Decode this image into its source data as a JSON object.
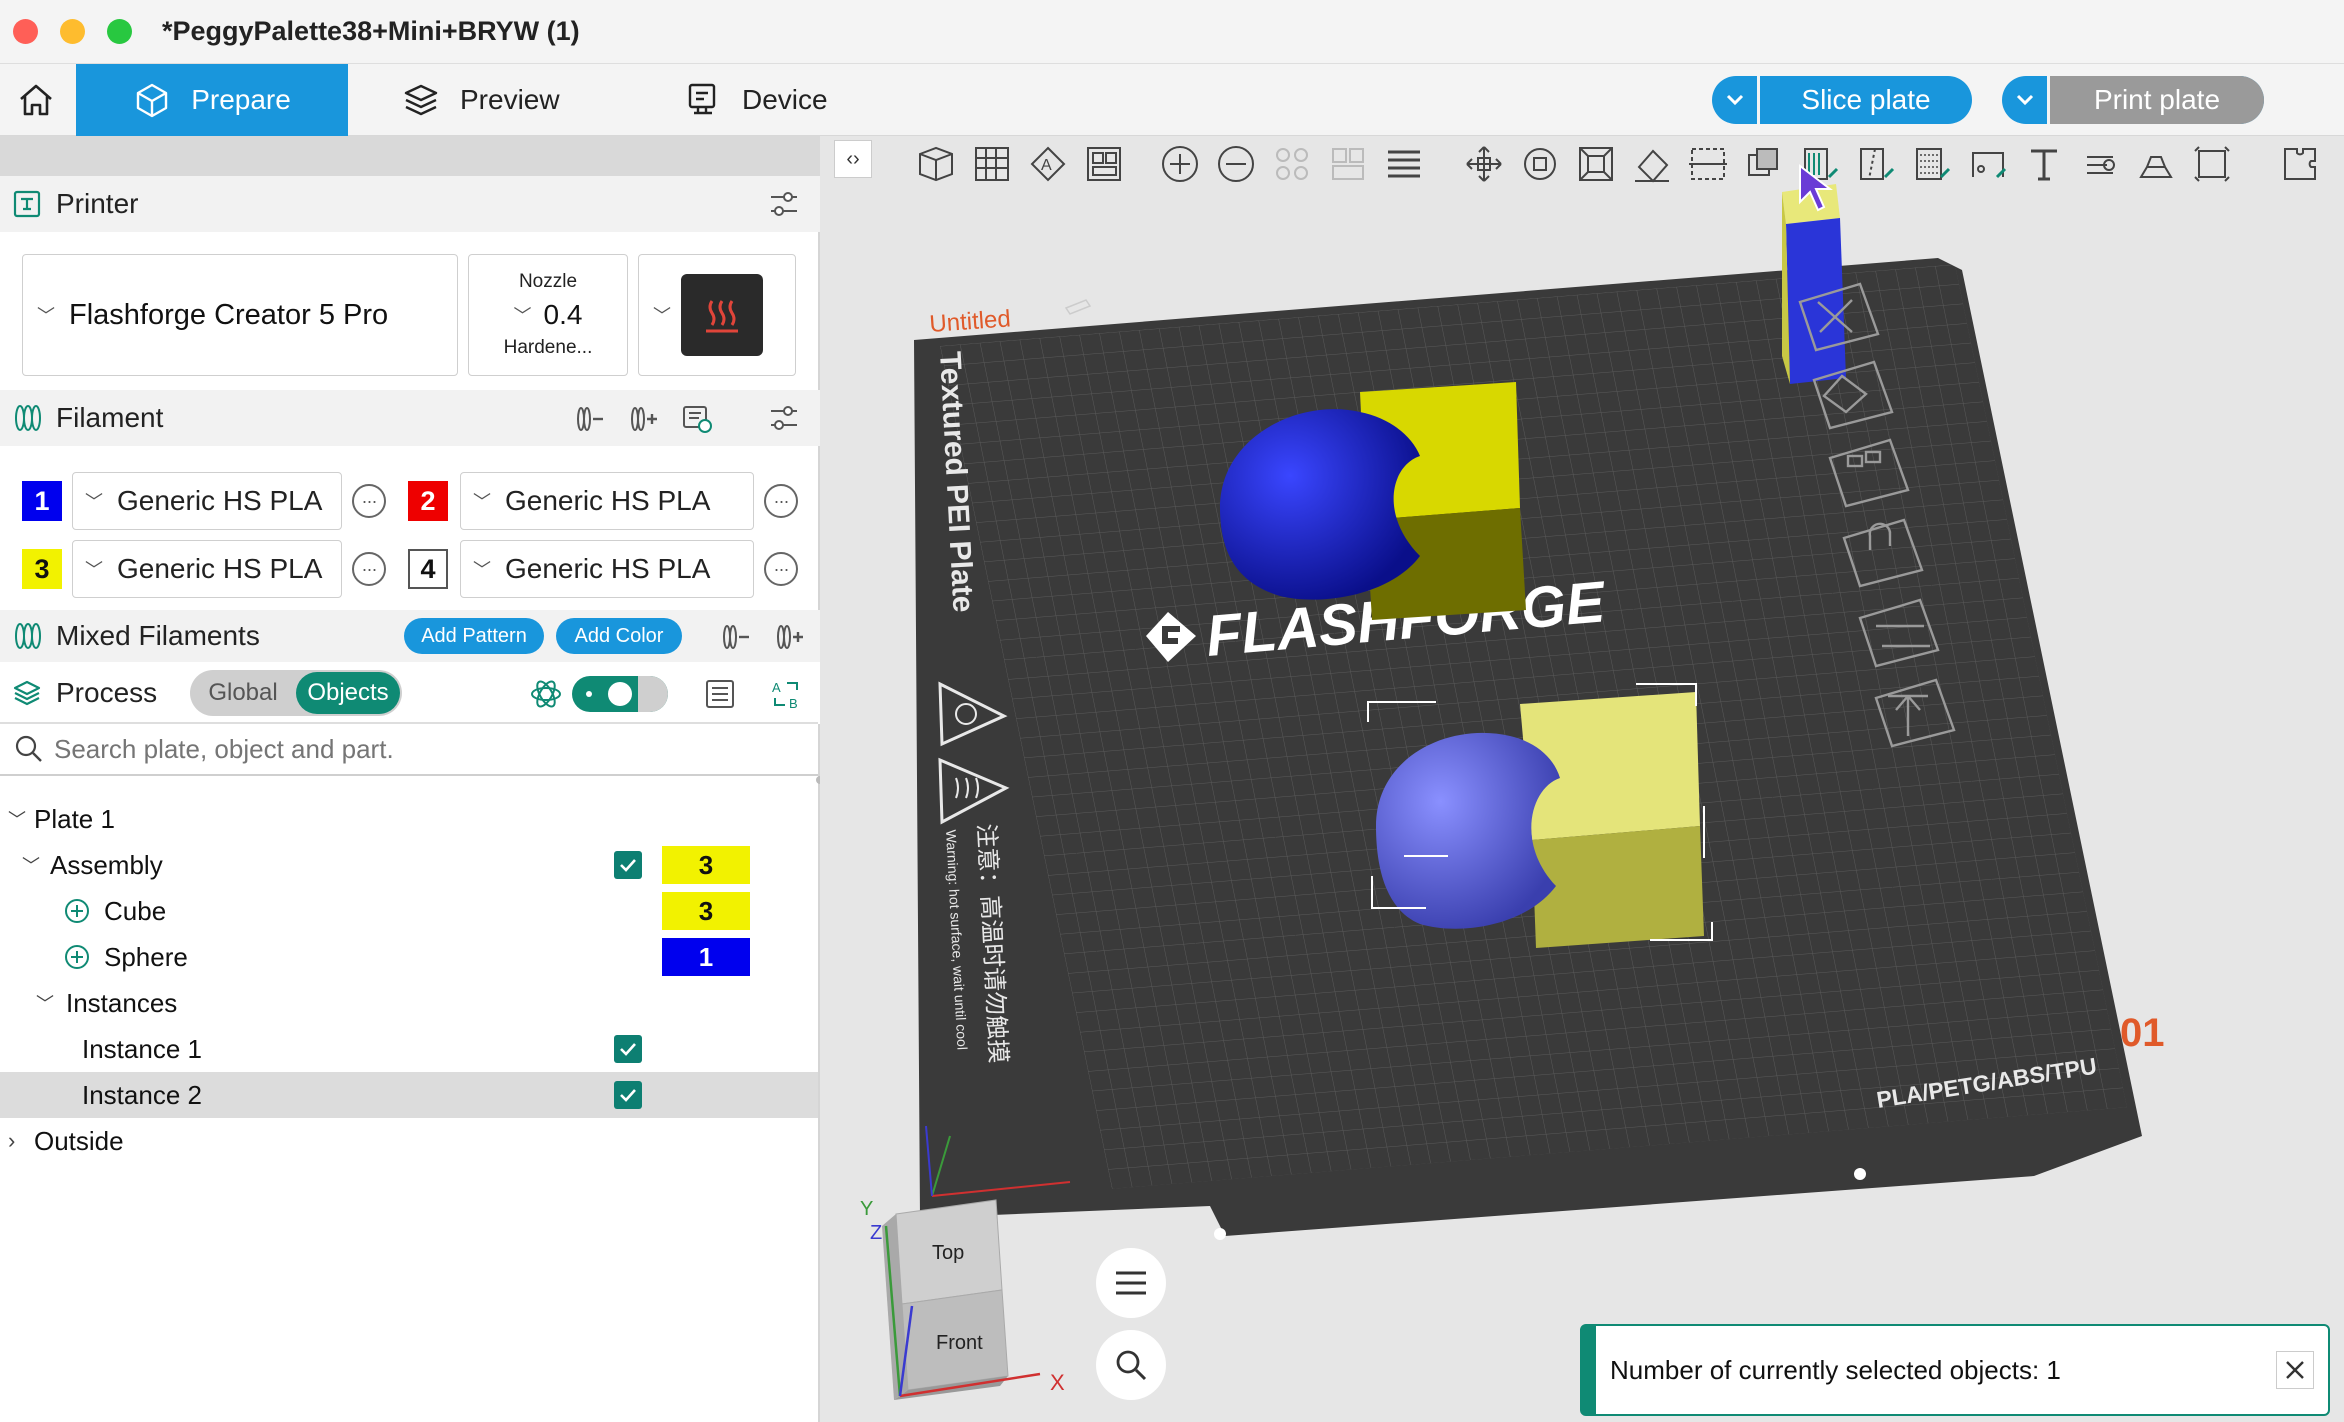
{
  "window": {
    "title": "*PeggyPalette38+Mini+BRYW (1)"
  },
  "tabs": [
    {
      "label": "Prepare"
    },
    {
      "label": "Preview"
    },
    {
      "label": "Device"
    }
  ],
  "actions": {
    "slice_label": "Slice plate",
    "print_label": "Print plate"
  },
  "printer": {
    "header": "Printer",
    "name": "Flashforge Creator 5 Pro",
    "nozzle_label": "Nozzle",
    "nozzle_value": "0.4",
    "nozzle_type": "Hardene..."
  },
  "filament": {
    "header": "Filament",
    "slots": [
      {
        "index": "1",
        "name": "Generic HS PLA",
        "color": "#0000ee",
        "text_color": "#ffffff"
      },
      {
        "index": "2",
        "name": "Generic HS PLA",
        "color": "#ee0000",
        "text_color": "#ffffff"
      },
      {
        "index": "3",
        "name": "Generic HS PLA",
        "color": "#f2f200",
        "text_color": "#111111"
      },
      {
        "index": "4",
        "name": "Generic HS PLA",
        "color": "#ffffff",
        "text_color": "#111111"
      }
    ]
  },
  "mixed": {
    "header": "Mixed Filaments",
    "add_pattern": "Add Pattern",
    "add_color": "Add Color"
  },
  "process": {
    "header": "Process",
    "toggle_global": "Global",
    "toggle_objects": "Objects",
    "active": "Objects"
  },
  "search": {
    "placeholder": "Search plate, object and part."
  },
  "tree": {
    "plate": "Plate 1",
    "assembly": {
      "label": "Assembly",
      "extruder": "3",
      "checked": true
    },
    "parts": [
      {
        "label": "Cube",
        "extruder": "3"
      },
      {
        "label": "Sphere",
        "extruder": "1"
      }
    ],
    "instances_label": "Instances",
    "instances": [
      {
        "label": "Instance 1",
        "checked": true,
        "selected": false
      },
      {
        "label": "Instance 2",
        "checked": true,
        "selected": true
      }
    ],
    "outside": "Outside"
  },
  "viewport": {
    "plate_name": "Untitled",
    "plate_number": "01",
    "bed_label": "Textured PEI Plate",
    "brand": "FLASHFORGE",
    "materials": "PLA/PETG/ABS/TPU",
    "warning_cn": "注意：高温时请勿触摸",
    "warning_en": "Warning: hot surface, wait until cool",
    "cube_top": "Top",
    "cube_front": "Front",
    "axis_x": "X",
    "axis_y": "Y",
    "axis_z": "Z"
  },
  "notification": {
    "text": "Number of currently selected objects: 1"
  },
  "colors": {
    "accent": "#1996dc",
    "teal": "#0f8a74",
    "bed": "#3a3a3a"
  }
}
